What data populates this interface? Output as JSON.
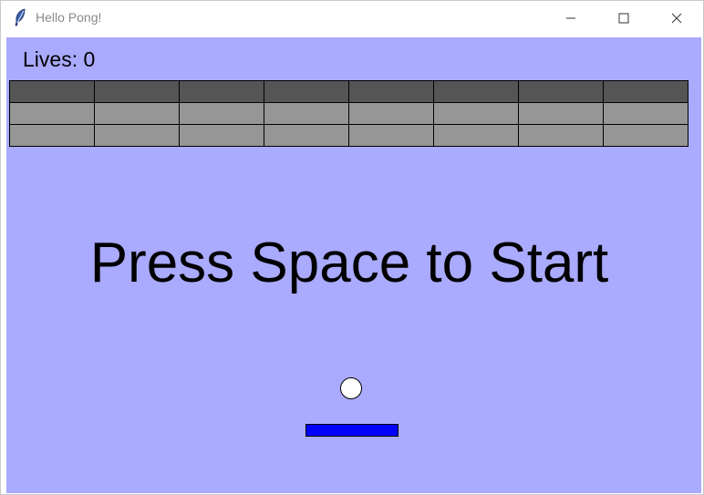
{
  "window": {
    "title": "Hello Pong!",
    "controls": [
      "minimize",
      "maximize",
      "close"
    ]
  },
  "game": {
    "lives_label": "Lives: 0",
    "start_message": "Press Space to Start",
    "colors": {
      "background": "#aaaaff",
      "ball": "#ffffff",
      "paddle": "#0000ff",
      "brick_rows": [
        "#555555",
        "#969696",
        "#969696"
      ]
    },
    "bricks": {
      "rows": 3,
      "columns": 8
    }
  }
}
